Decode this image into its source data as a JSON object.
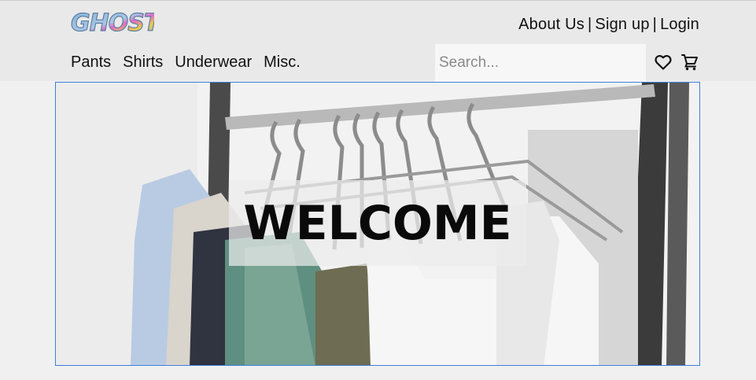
{
  "brand": {
    "logo_text": "GHOST"
  },
  "header": {
    "links": [
      {
        "label": "About Us"
      },
      {
        "label": "Sign up"
      },
      {
        "label": "Login"
      }
    ],
    "separator": "|"
  },
  "nav": {
    "items": [
      {
        "label": "Pants"
      },
      {
        "label": "Shirts"
      },
      {
        "label": "Underwear"
      },
      {
        "label": "Misc."
      }
    ]
  },
  "search": {
    "placeholder": "Search...",
    "value": ""
  },
  "icons": {
    "wishlist": "heart-icon",
    "cart": "cart-icon"
  },
  "hero": {
    "headline": "WELCOME"
  },
  "colors": {
    "header_bg": "#e9e9e9",
    "page_bg": "#f0f0f0",
    "hero_border": "#3d7fdc"
  }
}
